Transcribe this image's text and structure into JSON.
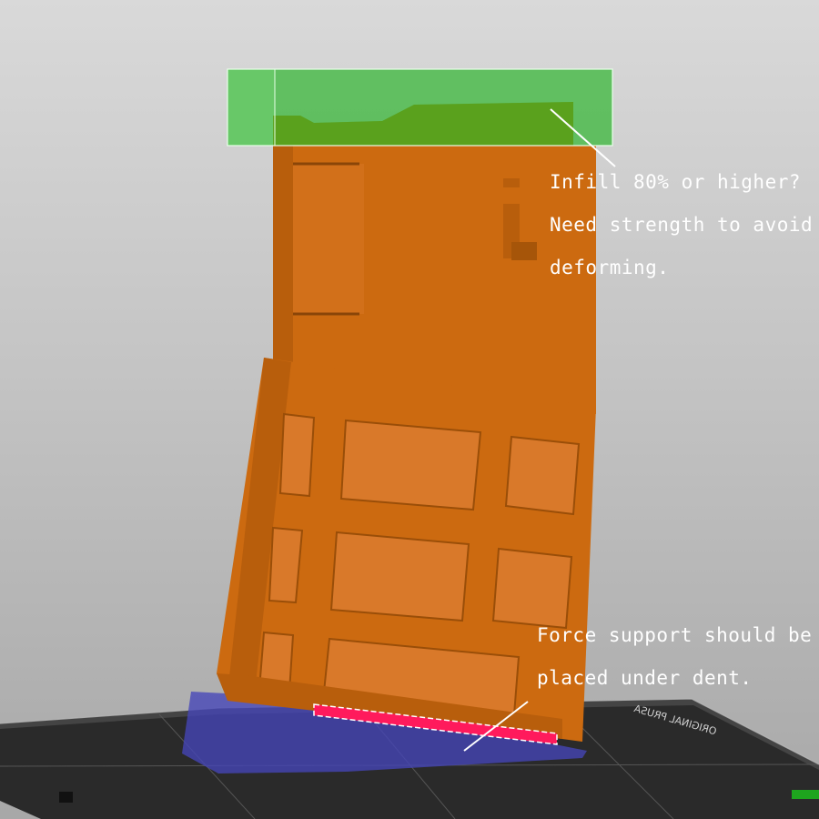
{
  "annotations": {
    "infill": {
      "lines": [
        "Infill 80% or higher?",
        "Need strength to avoid",
        "deforming."
      ]
    },
    "support": {
      "lines": [
        "Force support should be",
        "placed under dent."
      ]
    }
  },
  "bed_label": "ORIGINAL PRUSA",
  "colors": {
    "model": "#cc6a10",
    "modifier_volume": "#4cbb4c",
    "support_enforcer": "#4545b8",
    "painted_support": "#ff1a5c",
    "bed": "#2b2b2b",
    "background": "#c8c8c8"
  }
}
